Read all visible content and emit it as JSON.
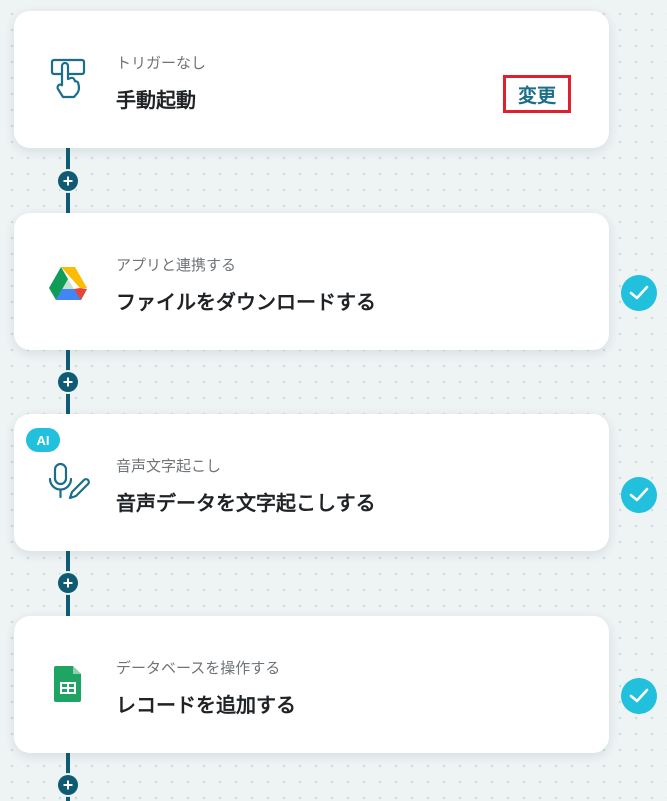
{
  "steps": [
    {
      "subtitle": "トリガーなし",
      "title": "手動起動",
      "action_label": "変更",
      "icon": "hand-pointer-icon"
    },
    {
      "subtitle": "アプリと連携する",
      "title": "ファイルをダウンロードする",
      "icon": "google-drive-icon",
      "status": "completed"
    },
    {
      "subtitle": "音声文字起こし",
      "title": "音声データを文字起こしする",
      "badge": "AI",
      "icon": "microphone-pen-icon",
      "status": "completed"
    },
    {
      "subtitle": "データベースを操作する",
      "title": "レコードを追加する",
      "icon": "google-sheets-icon",
      "status": "completed"
    }
  ],
  "colors": {
    "connector": "#0f5b73",
    "check": "#21c0dd",
    "highlight_border": "#e0202c",
    "accent_text": "#1a6e8a"
  }
}
